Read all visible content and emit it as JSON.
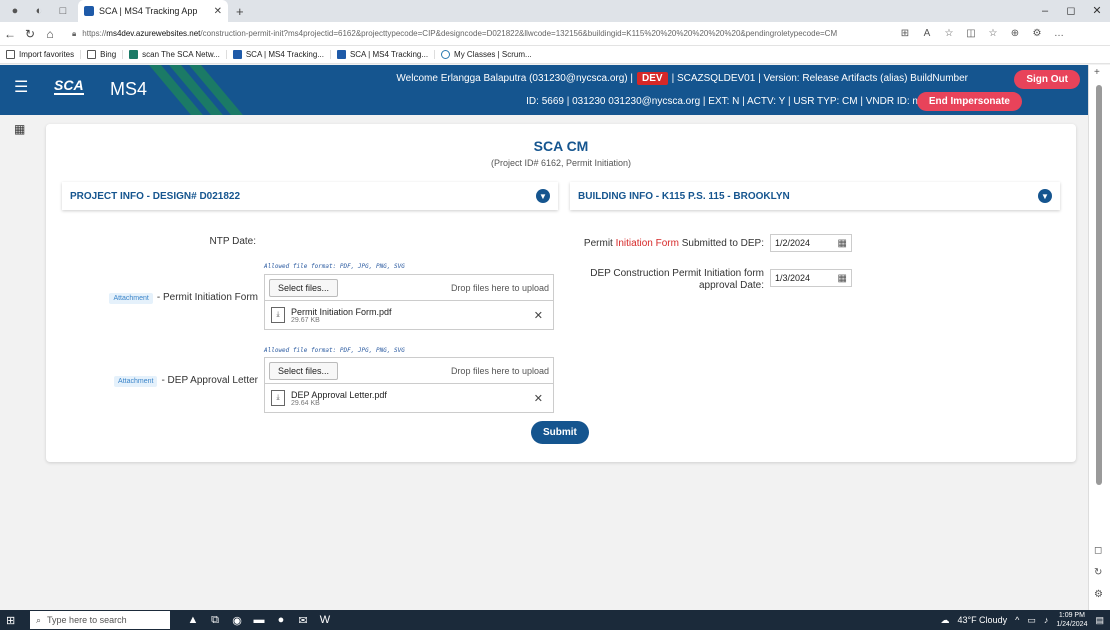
{
  "browser": {
    "tab_title": "SCA | MS4 Tracking App",
    "url_prefix": "https://",
    "url_host": "ms4dev.azurewebsites.net",
    "url_path": "/construction-permit-init?ms4projectid=6162&projecttypecode=CIP&designcode=D021822&llwcode=132156&buildingid=K115%20%20%20%20%20%20&pendingroletypecode=CM",
    "favorites": [
      "Import favorites",
      "Bing",
      "scan The SCA Netw...",
      "SCA | MS4 Tracking...",
      "SCA | MS4 Tracking...",
      "My Classes | Scrum..."
    ]
  },
  "header": {
    "logo": "SCA",
    "app_name": "MS4",
    "welcome_text": "Welcome Erlangga Balaputra (031230@nycsca.org) |",
    "env_badge": "DEV",
    "server_text": "| SCAZSQLDEV01 | Version: Release Artifacts (alias) BuildNumber",
    "sign_out": "Sign Out",
    "id_line": "ID: 5669 | 031230 031230@nycsca.org | EXT: N | ACTV: Y | USR TYP: CM | VNDR ID: null",
    "end_impersonate": "End Impersonate"
  },
  "main": {
    "title": "SCA CM",
    "subtitle": "(Project ID# 6162, Permit Initiation)",
    "project_panel": "PROJECT INFO - DESIGN# D021822",
    "building_panel": "BUILDING INFO - K115 P.S. 115 - BROOKLYN",
    "ntp_label": "NTP Date:",
    "allowed_formats": "Allowed file format: PDF, JPG, PNG, SVG",
    "attachment_badge": "Attachment",
    "permit_form_label": "- Permit Initiation Form",
    "dep_letter_label": "- DEP Approval Letter",
    "select_files": "Select files...",
    "drop_text": "Drop files here to upload",
    "file1": {
      "name": "Permit Initiation Form.pdf",
      "size": "29.67 KB"
    },
    "file2": {
      "name": "DEP Approval Letter.pdf",
      "size": "29.64 KB"
    },
    "submitted_label_pre": "Permit ",
    "submitted_label_red": "Initiation Form",
    "submitted_label_post": " Submitted to DEP:",
    "submitted_date": "1/2/2024",
    "approval_label_line1": "DEP Construction Permit Initiation form",
    "approval_label_line2": "approval Date:",
    "approval_date": "1/3/2024",
    "submit": "Submit"
  },
  "taskbar": {
    "search_placeholder": "Type here to search",
    "weather": "43°F Cloudy",
    "time": "1:09 PM",
    "date": "1/24/2024"
  },
  "colors": {
    "brand": "#15558f",
    "accent_red": "#e8435a",
    "dev_badge": "#d62828"
  }
}
